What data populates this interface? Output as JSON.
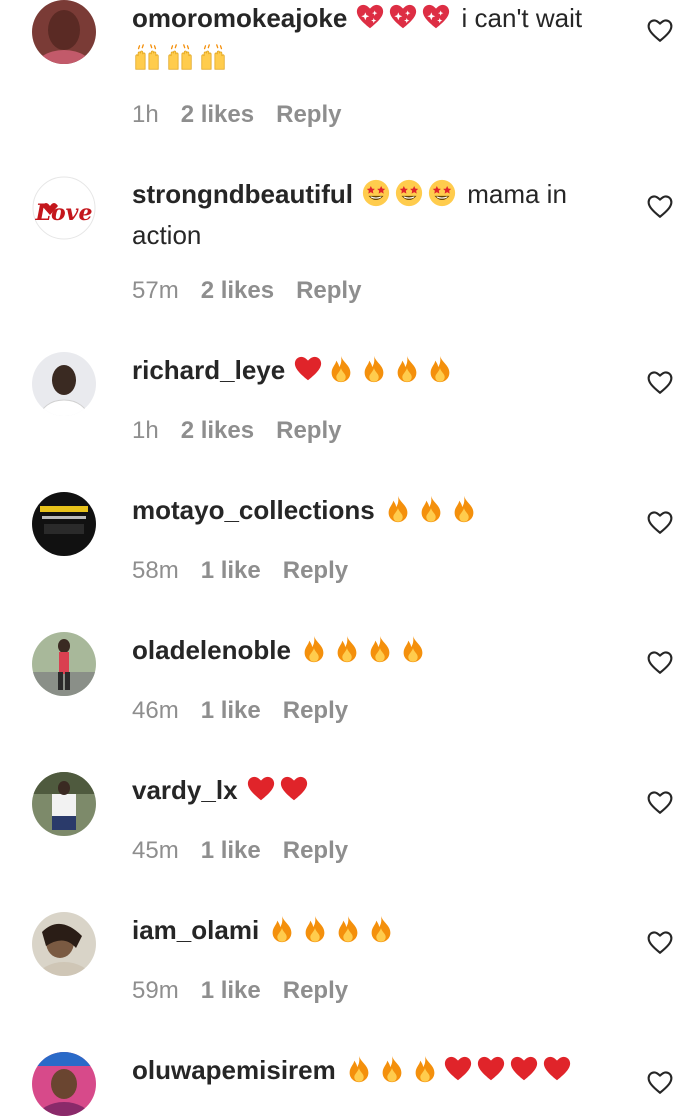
{
  "colors": {
    "text": "#262626",
    "muted": "#8e8e8e",
    "heart_red": "#e0242a",
    "fire_orange": "#f4900c",
    "fire_yellow": "#ffcc4d"
  },
  "icons": {
    "like": "heart-outline-icon",
    "sparkle_heart": "sparkling-heart-emoji",
    "raised_hands": "raising-hands-emoji",
    "star_struck": "star-struck-emoji",
    "heart": "red-heart-emoji",
    "fire": "fire-emoji"
  },
  "comments": [
    {
      "username": "omoromokeajoke",
      "emoji_before": [
        "sparkle_heart",
        "sparkle_heart",
        "sparkle_heart"
      ],
      "text": "i can't wait",
      "emoji_after": [
        "raised_hands",
        "raised_hands",
        "raised_hands"
      ],
      "time": "1h",
      "likes": "2 likes",
      "reply": "Reply"
    },
    {
      "username": "strongndbeautiful",
      "emoji_before": [
        "star_struck",
        "star_struck",
        "star_struck"
      ],
      "text": "mama in action",
      "emoji_after": [],
      "time": "57m",
      "likes": "2 likes",
      "reply": "Reply"
    },
    {
      "username": "richard_leye",
      "emoji_before": [
        "heart",
        "fire",
        "fire",
        "fire",
        "fire"
      ],
      "text": "",
      "emoji_after": [],
      "time": "1h",
      "likes": "2 likes",
      "reply": "Reply"
    },
    {
      "username": "motayo_collections",
      "emoji_before": [
        "fire",
        "fire",
        "fire"
      ],
      "text": "",
      "emoji_after": [],
      "time": "58m",
      "likes": "1 like",
      "reply": "Reply"
    },
    {
      "username": "oladelenoble",
      "emoji_before": [
        "fire",
        "fire",
        "fire",
        "fire"
      ],
      "text": "",
      "emoji_after": [],
      "time": "46m",
      "likes": "1 like",
      "reply": "Reply"
    },
    {
      "username": "vardy_lx",
      "emoji_before": [
        "heart",
        "heart"
      ],
      "text": "",
      "emoji_after": [],
      "time": "45m",
      "likes": "1 like",
      "reply": "Reply"
    },
    {
      "username": "iam_olami",
      "emoji_before": [
        "fire",
        "fire",
        "fire",
        "fire"
      ],
      "text": "",
      "emoji_after": [],
      "time": "59m",
      "likes": "1 like",
      "reply": "Reply"
    },
    {
      "username": "oluwapemisirem",
      "emoji_before": [
        "fire",
        "fire",
        "fire",
        "heart",
        "heart",
        "heart",
        "heart"
      ],
      "text": "",
      "emoji_after": [],
      "time": "",
      "likes": "",
      "reply": ""
    }
  ]
}
